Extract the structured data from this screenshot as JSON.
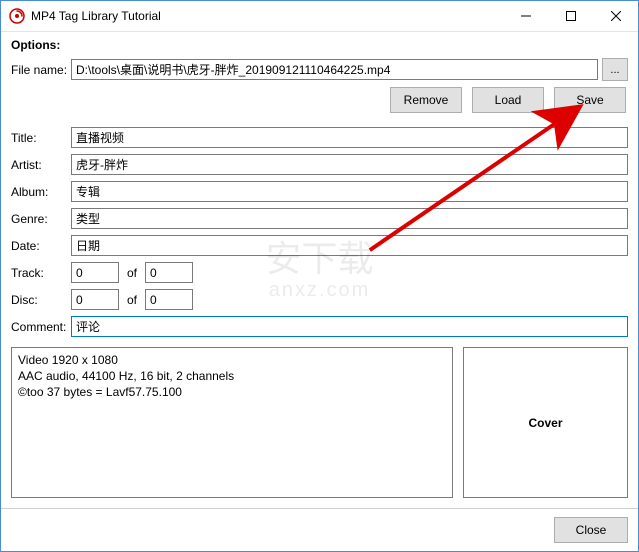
{
  "window": {
    "title": "MP4 Tag Library Tutorial"
  },
  "options_label": "Options:",
  "labels": {
    "file_name": "File name:",
    "title": "Title:",
    "artist": "Artist:",
    "album": "Album:",
    "genre": "Genre:",
    "date": "Date:",
    "track": "Track:",
    "disc": "Disc:",
    "comment": "Comment:",
    "of": "of",
    "cover": "Cover"
  },
  "buttons": {
    "browse": "...",
    "remove": "Remove",
    "load": "Load",
    "save": "Save",
    "close": "Close"
  },
  "fields": {
    "file_name": "D:\\tools\\桌面\\说明书\\虎牙-胖炸_201909121110464225.mp4",
    "title": "直播视频",
    "artist": "虎牙-胖炸",
    "album": "专辑",
    "genre": "类型",
    "date": "日期",
    "track_num": "0",
    "track_total": "0",
    "disc_num": "0",
    "disc_total": "0",
    "comment": "评论"
  },
  "info_panel": "Video 1920 x 1080\nAAC audio, 44100 Hz, 16 bit, 2 channels\n©too 37 bytes = Lavf57.75.100",
  "watermark": {
    "main": "安下载",
    "sub": "anxz.com"
  }
}
